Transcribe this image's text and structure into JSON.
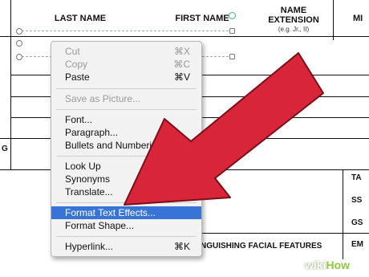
{
  "form": {
    "col_last_name": "LAST NAME",
    "col_first_name": "FIRST NAME",
    "col_name_ext_line1": "NAME",
    "col_name_ext_line2": "EXTENSION",
    "col_name_ext_hint": "(e.g. Jr., II)",
    "col_partial": "MI",
    "side_g": "G",
    "right_labels": [
      "TA",
      "SS",
      "GS",
      "EM"
    ],
    "lower_field": "NGUISHING FACIAL FEATURES"
  },
  "context_menu": {
    "items": [
      {
        "label": "Cut",
        "shortcut": "⌘X",
        "enabled": false
      },
      {
        "label": "Copy",
        "shortcut": "⌘C",
        "enabled": false
      },
      {
        "label": "Paste",
        "shortcut": "⌘V",
        "enabled": true
      },
      {
        "label": "Save as Picture...",
        "shortcut": "",
        "enabled": false
      },
      {
        "label": "Font...",
        "shortcut": "",
        "enabled": true
      },
      {
        "label": "Paragraph...",
        "shortcut": "",
        "enabled": true
      },
      {
        "label": "Bullets and Numberi",
        "shortcut": "",
        "enabled": true
      },
      {
        "label": "Look Up",
        "shortcut": "",
        "enabled": true
      },
      {
        "label": "Synonyms",
        "shortcut": "",
        "enabled": true
      },
      {
        "label": "Translate...",
        "shortcut": "",
        "enabled": true
      },
      {
        "label": "Format Text Effects...",
        "shortcut": "",
        "enabled": true,
        "highlighted": true
      },
      {
        "label": "Format Shape...",
        "shortcut": "",
        "enabled": true
      },
      {
        "label": "Hyperlink...",
        "shortcut": "⌘K",
        "enabled": true
      }
    ]
  },
  "overlay": {
    "arrow_color": "#d9253a",
    "highlight_color": "#3874d8"
  },
  "watermark": {
    "part1": "wiki",
    "part2": "How"
  }
}
